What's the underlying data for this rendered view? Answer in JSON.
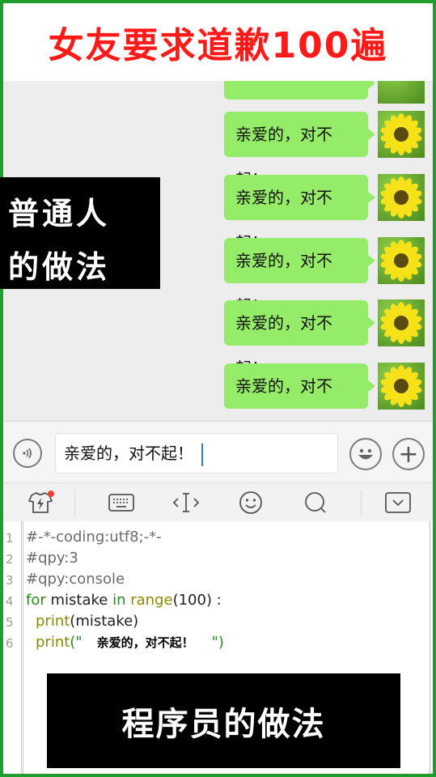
{
  "title": "女友要求道歉100遍",
  "chat": {
    "messages": [
      "亲爱的，对不起！",
      "亲爱的，对不起！",
      "亲爱的，对不起！",
      "亲爱的，对不起！",
      "亲爱的，对不起！"
    ],
    "avatar_icon": "sunflower-avatar"
  },
  "side_label": {
    "line1": "普通人",
    "line2": "的做法"
  },
  "input_bar": {
    "value": "亲爱的，对不起！",
    "voice_icon": "voice-icon",
    "emoji_icon": "emoji-icon",
    "plus_icon": "plus-icon"
  },
  "toolbar": {
    "icons": [
      "shirt-lightning-icon",
      "keyboard-icon",
      "text-cursor-icon",
      "smiley-icon",
      "search-icon",
      "collapse-icon"
    ]
  },
  "code": {
    "line_numbers": [
      "1",
      "2",
      "3",
      "4",
      "5",
      "6"
    ],
    "line1": "#-*-coding:utf8;-*-",
    "line2": "#qpy:3",
    "line3": "#qpy:console",
    "line4_for": "for",
    "line4_var": " mistake ",
    "line4_in": "in",
    "line4_sp": " ",
    "line4_range": "range",
    "line4_rest": "(100) :",
    "line5_print": "print",
    "line5_rest": "(mistake)",
    "line6_print": "print",
    "line6_open": "(\"",
    "line6_text": "亲爱的，对不起！",
    "line6_close": "\")"
  },
  "programmer_label": "程序员的做法",
  "colors": {
    "frame_green": "#1f9e2d",
    "title_red": "#ff1a1a",
    "bubble_green": "#95ec69",
    "chat_bg": "#ededed"
  }
}
